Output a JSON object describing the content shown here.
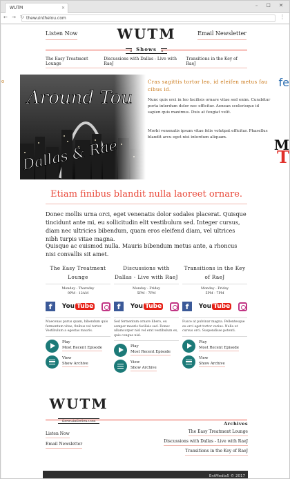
{
  "browser": {
    "tab_title": "WUTM",
    "tab_close": "×",
    "window_controls": "–  ☐  ✕",
    "nav": "←  →  ↻",
    "url": "thewuinthelou.com",
    "menu": "⋮"
  },
  "header": {
    "listen_now": "Listen Now",
    "email_newsletter": "Email Newsletter",
    "logo": "WUTM",
    "logo_sub": "thewuinthelou.com",
    "shows_label": "Shows",
    "show_links": [
      "The Easy Treatment Lounge",
      "Discussions with Dallas - Live with RaeJ",
      "Transitions in the Key of RaeJ"
    ]
  },
  "sidebar": {
    "left_fragment": "o",
    "right_fragment_1": "fe",
    "right_fragment_2": "M",
    "right_fragment_3": "T"
  },
  "featured": {
    "image_text_1": "Around Tou",
    "image_text_2": "Dallas & Rae",
    "heading": "Cras sagittis tortor leo, id eleifen metus fau cibus id.",
    "para1": "Nunc quis orci in leo facilisis ornare vitae sed enim. Curabitur porta interdum dolor nec efficitur. Aenean scelerisque id sapien quis maximus. Duis at feugiat velit.",
    "para2": "Morbi venenatis ipsum vitae felis volutpat efficitur. Phasellus blandit arcu eget nisi interdum aliquam."
  },
  "tagline": "Etiam finibus blandit nulla laoreet ornare.",
  "intro": {
    "p1": "Donec mollis urna orci, eget venenatis dolor sodales placerat. Quisque tincidunt ante mi, eu sollicitudin elit vestibulum sed. Integer cursus, diam nec ultricies bibendum, quam eros eleifend diam, vel ultrices nibh turpis vitae magna.",
    "p2": "Quisque ac euismod nulla. Mauris bibendum metus ante, a rhoncus nisi convallis sit amet."
  },
  "columns": [
    {
      "title": "The Easy Treatment Lounge",
      "days": "Monday - Thursday",
      "time": "9PM - 12AM",
      "desc": "Maecenas purus quam, bibendum quis fermentum vitae, finibus vel tortor. Vestibulum a egestas mauris.",
      "play": "Play",
      "recent": "Most Recent Episode",
      "view": "View",
      "archive": "Show Archive"
    },
    {
      "title": "Discussions with Dallas - Live with RaeJ",
      "days": "Monday - Friday",
      "time": "5PM - 7PM",
      "desc": "Sed fermentum ornare libero, eu semper mauris facilisis sed. Donec ullamcorper nisl vel erat vestibulum ex, quis congue nisl.",
      "play": "Play",
      "recent": "Most Recent Episode",
      "view": "View",
      "archive": "Show Archive"
    },
    {
      "title": "Transitions in the Key of RaeJ",
      "days": "Monday - Friday",
      "time": "5PM - 7PM",
      "desc": "Fusce at pulvinar magna. Pellentesque eu orci eget tortor varius. Nulla ut cursus orci. Suspendisse potenti.",
      "play": "Play",
      "recent": "Most Recent Episode",
      "view": "View",
      "archive": "Show Archive"
    }
  ],
  "social": {
    "fb": "f",
    "yt_you": "You",
    "yt_tube": "Tube"
  },
  "footer": {
    "logo": "WUTM",
    "logo_sub": "thewuinthelou.com",
    "listen_now": "Listen Now",
    "email_newsletter": "Email Newsletter",
    "archives_label": "Archives",
    "archive_links": [
      "The Easy Treatment Lounge",
      "Discussions with Dallas - Live with RaeJ",
      "Transitions in the Key of RaeJ"
    ],
    "copyright": "EntMedia5 © 2017"
  }
}
